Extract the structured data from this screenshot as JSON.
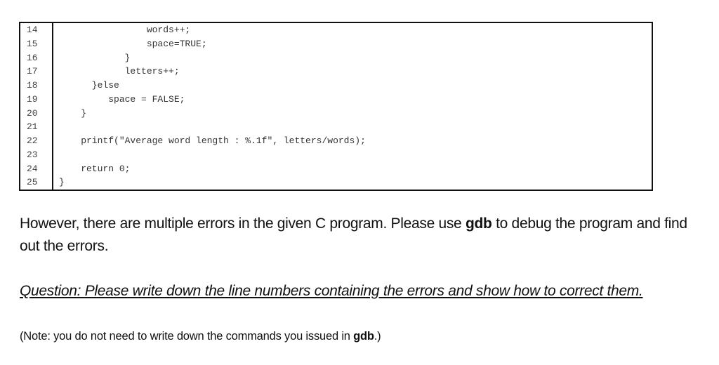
{
  "code_listing": {
    "lines": [
      {
        "number": "14",
        "text": "                words++;"
      },
      {
        "number": "15",
        "text": "                space=TRUE;"
      },
      {
        "number": "16",
        "text": "            }"
      },
      {
        "number": "17",
        "text": "            letters++;"
      },
      {
        "number": "18",
        "text": "      }else"
      },
      {
        "number": "19",
        "text": "         space = FALSE;"
      },
      {
        "number": "20",
        "text": "    }"
      },
      {
        "number": "21",
        "text": ""
      },
      {
        "number": "22",
        "text": "    printf(\"Average word length : %.1f\", letters/words);"
      },
      {
        "number": "23",
        "text": ""
      },
      {
        "number": "24",
        "text": "    return 0;"
      },
      {
        "number": "25",
        "text": "}"
      }
    ]
  },
  "intro": {
    "before_bold": "However, there are multiple errors in the given C program. Please use ",
    "bold": "gdb",
    "after_bold": " to debug the program and find out the errors."
  },
  "question": {
    "text": "Question: Please write down the line numbers containing the errors and show how to correct them."
  },
  "note": {
    "before_bold": "(Note: you do not need to write down the commands you issued in ",
    "bold": "gdb",
    "after_bold": ".)"
  }
}
